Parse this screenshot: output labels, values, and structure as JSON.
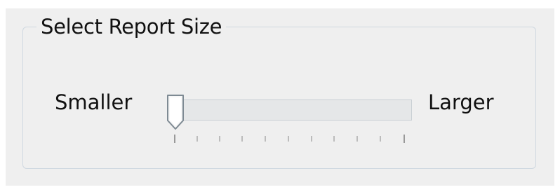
{
  "group": {
    "title": "Select Report Size"
  },
  "slider": {
    "min_label": "Smaller",
    "max_label": "Larger",
    "value": 0,
    "min": 0,
    "max": 10
  },
  "colors": {
    "panel_bg": "#efefef",
    "border": "#cfd8e0",
    "track": "#e5e7e8",
    "text": "#111111"
  }
}
